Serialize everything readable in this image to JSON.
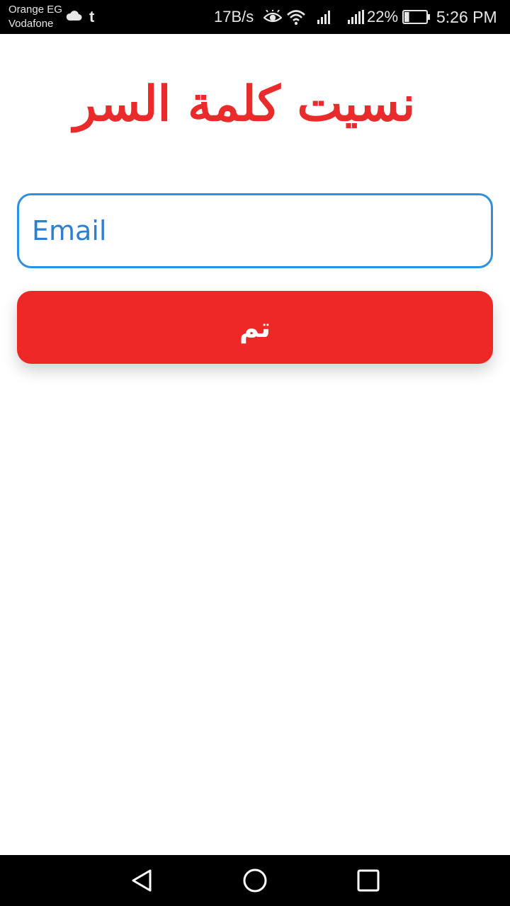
{
  "status_bar": {
    "carrier_1": "Orange EG",
    "carrier_2": "Vodafone",
    "tumblr_glyph": "t",
    "net_speed": "17B/s",
    "battery_percent": "22%",
    "battery_level": 0.22,
    "time": "5:26 PM",
    "icons": [
      "cloud-icon",
      "tumblr-icon",
      "eye-icon",
      "wifi-icon",
      "signal-icon",
      "signal-icon",
      "battery-icon"
    ]
  },
  "title": "نسيت كلمة السر",
  "form": {
    "email_placeholder": "Email",
    "email_value": "",
    "submit_label": "تم"
  },
  "nav_bar": {
    "icons": [
      "back-icon",
      "home-icon",
      "recents-icon"
    ]
  },
  "colors": {
    "accent_red": "#ee2727",
    "field_border_blue": "#2f8fe0",
    "placeholder_blue": "#2d7fd0"
  }
}
